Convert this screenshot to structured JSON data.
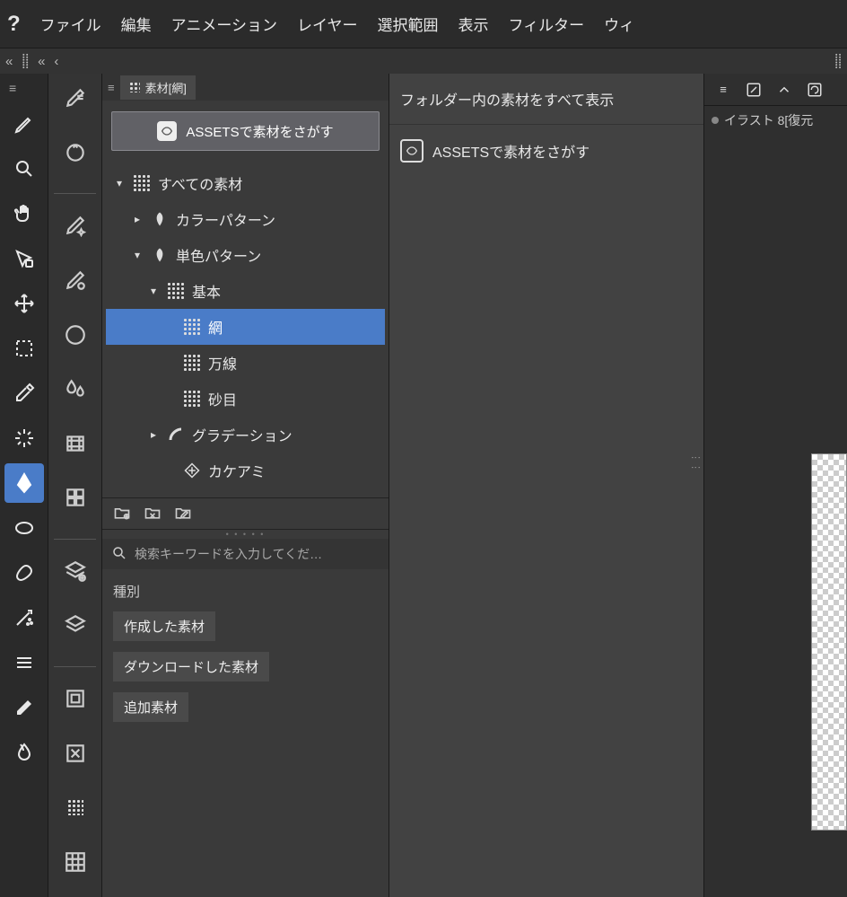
{
  "menubar": {
    "items": [
      "ファイル",
      "編集",
      "アニメーション",
      "レイヤー",
      "選択範囲",
      "表示",
      "フィルター",
      "ウィ"
    ]
  },
  "material_panel": {
    "tab_label": "素材[網]",
    "assets_button": "ASSETSで素材をさがす",
    "tree": {
      "all": "すべての素材",
      "color_pattern": "カラーパターン",
      "mono_pattern": "単色パターン",
      "basic": "基本",
      "ami": "網",
      "mansen": "万線",
      "sname": "砂目",
      "gradation": "グラデーション",
      "kakeami": "カケアミ"
    },
    "search_placeholder": "検索キーワードを入力してくだ…",
    "filters": {
      "heading": "種別",
      "created": "作成した素材",
      "downloaded": "ダウンロードした素材",
      "additional": "追加素材"
    }
  },
  "preview": {
    "show_all": "フォルダー内の素材をすべて表示",
    "assets_link": "ASSETSで素材をさがす"
  },
  "right": {
    "doc_name": "イラスト 8[復元"
  }
}
